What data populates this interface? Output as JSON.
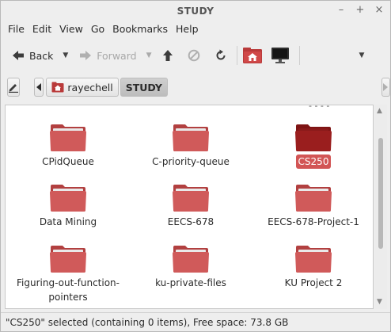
{
  "window": {
    "title": "STUDY",
    "controls": [
      "–",
      "+",
      "×"
    ]
  },
  "menubar": {
    "items": [
      "File",
      "Edit",
      "View",
      "Go",
      "Bookmarks",
      "Help"
    ]
  },
  "toolbar": {
    "back_label": "Back",
    "forward_label": "Forward"
  },
  "location": {
    "crumbs": [
      "rayechell",
      "STUDY"
    ]
  },
  "files": [
    {
      "name": "CPidQueue",
      "selected": false
    },
    {
      "name": "C-priority-queue",
      "selected": false
    },
    {
      "name": "CS250",
      "selected": true
    },
    {
      "name": "Data Mining",
      "selected": false
    },
    {
      "name": "EECS-678",
      "selected": false
    },
    {
      "name": "EECS-678-Project-1",
      "selected": false
    },
    {
      "name": "Figuring-out-function-\npointers",
      "selected": false
    },
    {
      "name": "ku-private-files",
      "selected": false
    },
    {
      "name": "KU Project 2",
      "selected": false
    }
  ],
  "statusbar": {
    "text": "\"CS250\" selected (containing 0 items), Free space: 73.8 GB"
  },
  "colors": {
    "folder": "#d05a5a",
    "folder_selected": "#9a1e1e",
    "selection": "#d25555"
  }
}
